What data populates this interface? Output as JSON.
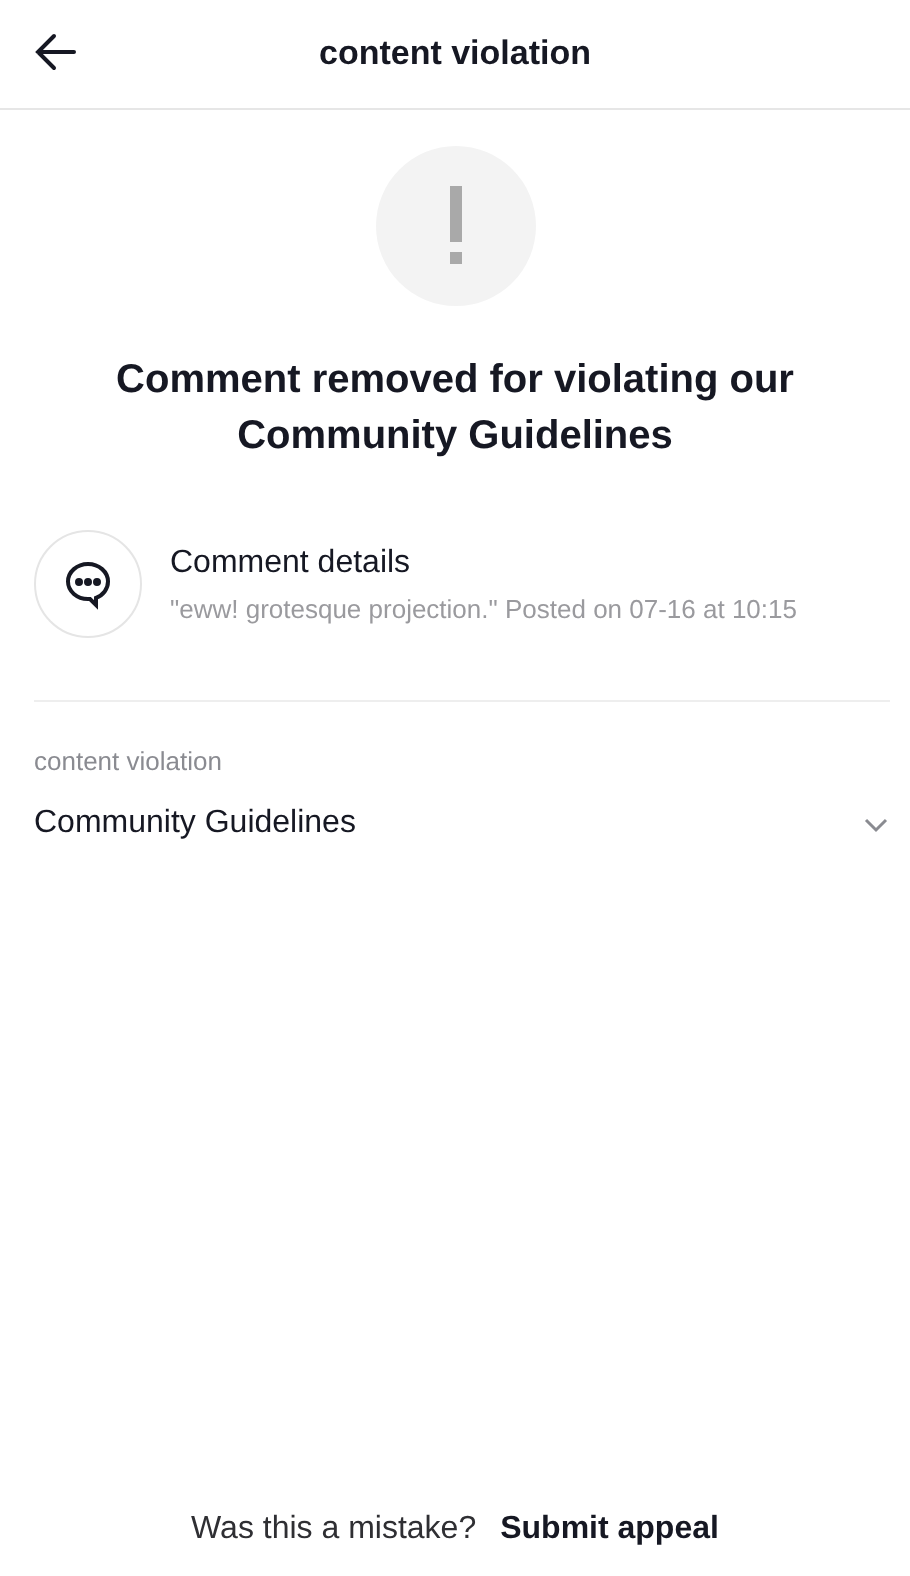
{
  "header": {
    "title": "content violation"
  },
  "notice": {
    "heading": "Comment removed for violating our Community Guidelines"
  },
  "comment": {
    "title": "Comment details",
    "detail": "\"eww! grotesque projection.\" Posted on 07-16 at 10:15"
  },
  "section": {
    "label": "content violation",
    "value": "Community Guidelines",
    "expanded": false
  },
  "footer": {
    "question": "Was this a mistake?",
    "action": "Submit appeal"
  }
}
